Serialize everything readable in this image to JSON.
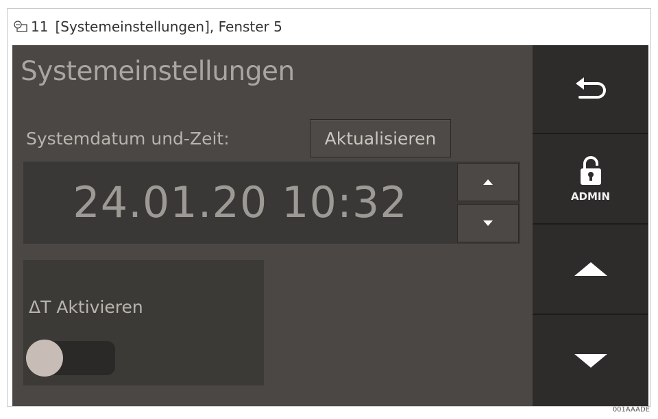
{
  "caption": {
    "icon": "screen-figure-icon",
    "number": "11",
    "text": "[Systemeinstellungen], Fenster 5"
  },
  "screen": {
    "title": "Systemeinstellungen",
    "datetime_label": "Systemdatum und-Zeit:",
    "update_button": "Aktualisieren",
    "datetime_value": "24.01.20 10:32",
    "delta_t": {
      "label": "ΔT Aktivieren",
      "enabled": false
    }
  },
  "sidebar": {
    "back_icon": "back-arrow-icon",
    "admin_icon": "unlocked-padlock-icon",
    "admin_label": "ADMIN",
    "scroll_up_icon": "triangle-up-icon",
    "scroll_down_icon": "triangle-down-icon"
  },
  "image_code": "001AAADE",
  "colors": {
    "panel_bg": "#4a4744",
    "sidebar_bg": "#2a2827",
    "text_light": "#b8b4ae",
    "toggle_knob": "#c7bdb6",
    "icon_white": "#ffffff"
  }
}
